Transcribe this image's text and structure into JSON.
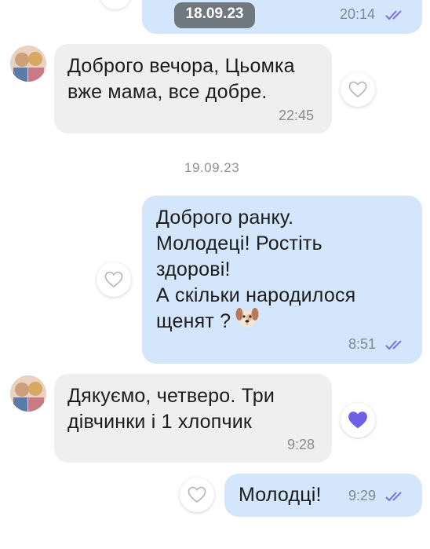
{
  "chat": {
    "date_pill": "18.09.23",
    "date_separator": "19.09.23",
    "messages": [
      {
        "direction": "out",
        "text": "",
        "time": "20:14",
        "status": "read"
      },
      {
        "direction": "in",
        "text": "Доброго вечора, Цьомка\nвже мама, все добре.",
        "time": "22:45",
        "liked": false
      },
      {
        "direction": "out",
        "text": "Доброго ранку.\nМолодеці! Ростіть\nздорові!\nА скільки народилося\nщенят ?",
        "emoji": "dog-face",
        "time": "8:51",
        "status": "read",
        "liked": false
      },
      {
        "direction": "in",
        "text": "Дякуємо, четверо. Три\nдівчинки і 1 хлопчик",
        "time": "9:28",
        "liked": true
      },
      {
        "direction": "out",
        "text": "Молодці!",
        "time": "9:29",
        "status": "read",
        "liked": false
      }
    ]
  },
  "colors": {
    "outgoing_bubble": "#d3e6fb",
    "incoming_bubble": "#efefef",
    "read_ticks": "#7c6ee0",
    "liked_heart": "#6f5ee8"
  }
}
